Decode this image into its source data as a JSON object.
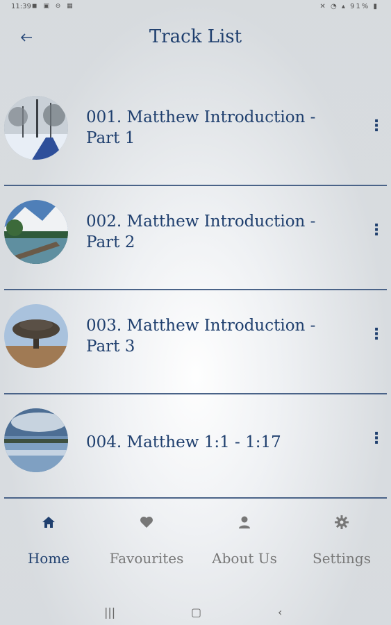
{
  "status": {
    "time": "11:39",
    "battery": "91%"
  },
  "header": {
    "title": "Track List"
  },
  "tracks": [
    {
      "title": "001. Matthew Introduction - Part 1"
    },
    {
      "title": "002. Matthew Introduction - Part 2"
    },
    {
      "title": "003. Matthew Introduction - Part 3"
    },
    {
      "title": "004. Matthew 1:1 - 1:17"
    }
  ],
  "nav": {
    "home": "Home",
    "favourites": "Favourites",
    "about": "About Us",
    "settings": "Settings"
  },
  "colors": {
    "accent": "#1f3f6e",
    "divider": "#4a6388",
    "inactive": "#777777"
  },
  "icons": [
    "back-arrow-icon",
    "more-vert-icon",
    "home-icon",
    "heart-icon",
    "person-icon",
    "gear-icon"
  ]
}
